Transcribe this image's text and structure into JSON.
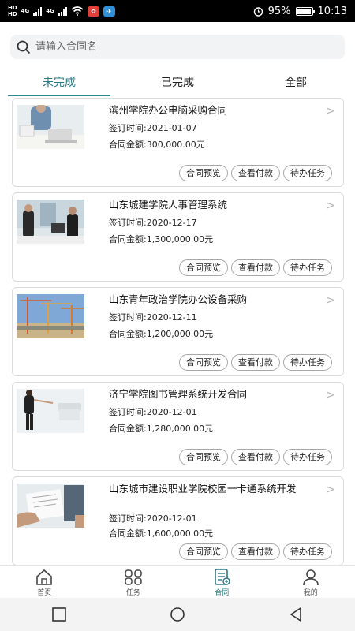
{
  "status_bar": {
    "hd_top": "HD",
    "hd_bottom": "HD",
    "net_1": "4G",
    "net_2": "4G",
    "battery_text": "95%",
    "time": "10:13",
    "battery_level": 0.95
  },
  "search": {
    "placeholder": "请输入合同名",
    "value": ""
  },
  "tabs": [
    {
      "label": "未完成",
      "active": true
    },
    {
      "label": "已完成",
      "active": false
    },
    {
      "label": "全部",
      "active": false
    }
  ],
  "contracts": [
    {
      "title": "滨州学院办公电脑采购合同",
      "date": "签订时间:2021-01-07",
      "amount": "合同金额:300,000.00元",
      "thumb": "office-laptop-photo"
    },
    {
      "title": "山东城建学院人事管理系统",
      "date": "签订时间:2020-12-17",
      "amount": "合同金额:1,300,000.00元",
      "thumb": "business-meeting-photo"
    },
    {
      "title": "山东青年政治学院办公设备采购",
      "date": "签订时间:2020-12-11",
      "amount": "合同金额:1,200,000.00元",
      "thumb": "construction-cranes-photo"
    },
    {
      "title": "济宁学院图书管理系统开发合同",
      "date": "签订时间:2020-12-01",
      "amount": "合同金额:1,280,000.00元",
      "thumb": "presentation-photo"
    },
    {
      "title": "山东城市建设职业学院校园一卡通系统开发",
      "date": "签订时间:2020-12-01",
      "amount": "合同金额:1,600,000.00元",
      "thumb": "signing-document-photo"
    }
  ],
  "card_actions": {
    "preview": "合同预览",
    "payment": "查看付款",
    "todo": "待办任务"
  },
  "bottom_nav": [
    {
      "label": "首页",
      "icon": "home-icon",
      "active": false
    },
    {
      "label": "任务",
      "icon": "tasks-icon",
      "active": false
    },
    {
      "label": "合同",
      "icon": "contract-icon",
      "active": true
    },
    {
      "label": "我的",
      "icon": "user-icon",
      "active": false
    }
  ],
  "system_nav": [
    "recent-apps-icon",
    "home-circle-icon",
    "back-icon"
  ],
  "colors": {
    "accent": "#2c7a86",
    "status_bar_bg": "#000000",
    "search_bg": "#f2f3f5"
  }
}
